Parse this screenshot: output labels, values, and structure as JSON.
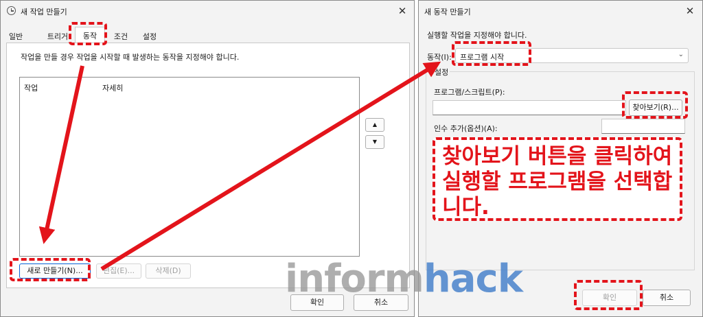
{
  "left_dialog": {
    "title": "새 작업 만들기",
    "close": "✕",
    "tabs": [
      "일반",
      "트리거",
      "동작",
      "조건",
      "설정"
    ],
    "description": "작업을 만들 경우 작업을 시작할 때 발생하는 동작을 지정해야 합니다.",
    "columns": [
      "작업",
      "자세히"
    ],
    "move_up": "▲",
    "move_down": "▼",
    "new_button": "새로 만들기(N)...",
    "edit_button": "편집(E)...",
    "delete_button": "삭제(D)",
    "ok_button": "확인",
    "cancel_button": "취소"
  },
  "right_dialog": {
    "title": "새 동작 만들기",
    "close": "✕",
    "instruction": "실행할 작업을 지정해야 합니다.",
    "action_label": "동작(I):",
    "action_value": "프로그램 시작",
    "settings_label": "설정",
    "program_label": "프로그램/스크립트(P):",
    "program_value": "",
    "browse_button": "찾아보기(R)...",
    "args_label": "인수 추가(옵션)(A):",
    "args_value": "",
    "ok_button": "확인",
    "cancel_button": "취소"
  },
  "annotation": {
    "callout": "찾아보기 버튼을 클릭하여 실행할 프로그램을 선택합니다.",
    "accent_color": "#e3141b"
  },
  "watermark": {
    "part1": "inform",
    "part2": "hack"
  }
}
